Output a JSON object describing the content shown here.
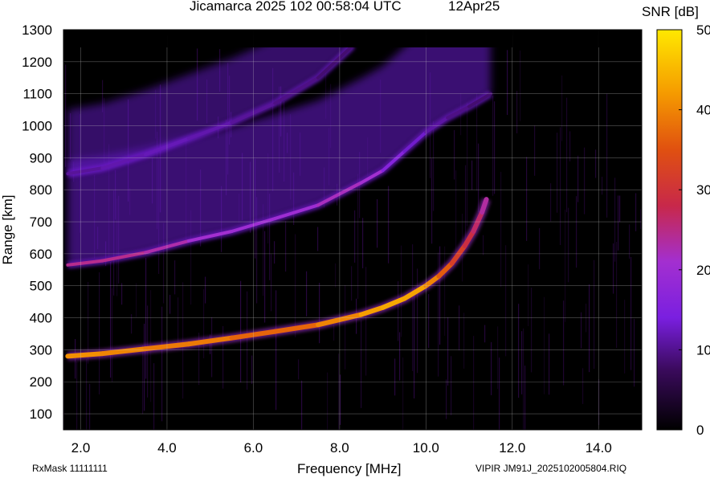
{
  "header": {
    "station_line": "Jicamarca 2025 102 00:58:04 UTC",
    "date": "12Apr25"
  },
  "footer": {
    "rx_mask": "RxMask 11111111",
    "file": "VIPIR  JM91J_2025102005804.RIQ"
  },
  "colorbar": {
    "title": "SNR [dB]",
    "ticks": [
      "0",
      "10",
      "20",
      "30",
      "40",
      "50"
    ],
    "min": 0,
    "max": 50,
    "colors": [
      "#000000",
      "#3a0a5c",
      "#7a1fe0",
      "#a32fd0",
      "#c8284a",
      "#e05010",
      "#f59a00",
      "#ffe800"
    ]
  },
  "chart_data": {
    "type": "heatmap",
    "title": "Jicamarca 2025 102 00:58:04 UTC",
    "xlabel": "Frequency [MHz]",
    "ylabel": "Range [km]",
    "xlim": [
      1.6,
      15.0
    ],
    "ylim": [
      50,
      1300
    ],
    "x_ticks": [
      "2.0",
      "4.0",
      "6.0",
      "8.0",
      "10.0",
      "12.0",
      "14.0"
    ],
    "y_ticks": [
      "100",
      "200",
      "300",
      "400",
      "500",
      "600",
      "700",
      "800",
      "900",
      "1000",
      "1100",
      "1200",
      "1300"
    ],
    "grid": true,
    "colorbar_label": "SNR [dB]",
    "series": [
      {
        "name": "",
        "trace": "one-hop F-layer echo",
        "x": [
          1.7,
          2.5,
          3.5,
          4.5,
          5.5,
          6.5,
          7.5,
          8.5,
          9.0,
          9.5,
          10.0,
          10.3,
          10.6,
          10.9,
          11.1,
          11.3,
          11.4
        ],
        "y": [
          280,
          288,
          303,
          318,
          337,
          357,
          378,
          410,
          432,
          460,
          500,
          530,
          570,
          625,
          670,
          730,
          770
        ],
        "snr_db": [
          40,
          42,
          38,
          40,
          38,
          36,
          38,
          42,
          43,
          44,
          42,
          38,
          34,
          30,
          28,
          25,
          22
        ]
      },
      {
        "name": "",
        "trace": "two-hop echo",
        "x": [
          1.7,
          2.5,
          3.5,
          4.5,
          5.5,
          6.5,
          7.5,
          8.5,
          9.0,
          9.5,
          10.0,
          10.5,
          11.0,
          11.5
        ],
        "y": [
          565,
          578,
          604,
          640,
          670,
          710,
          752,
          822,
          860,
          920,
          980,
          1025,
          1060,
          1100
        ],
        "snr_db": [
          24,
          25,
          24,
          22,
          20,
          20,
          20,
          24,
          18,
          14,
          12,
          10,
          9,
          8
        ]
      },
      {
        "name": "",
        "trace": "three-hop echo",
        "x": [
          1.7,
          2.5,
          3.5,
          4.5,
          5.5,
          6.5,
          7.5,
          8.3
        ],
        "y": [
          850,
          868,
          910,
          960,
          1010,
          1070,
          1150,
          1250
        ],
        "snr_db": [
          10,
          11,
          12,
          12,
          11,
          10,
          9,
          8
        ]
      }
    ]
  }
}
